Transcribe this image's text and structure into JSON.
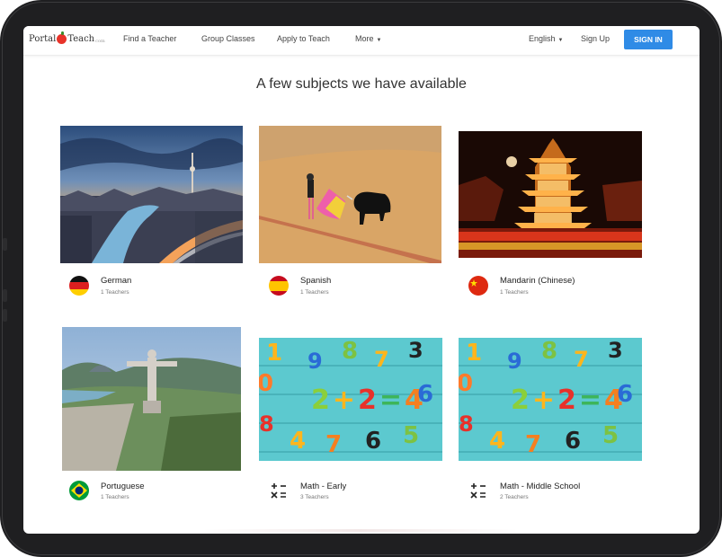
{
  "nav": {
    "logo_main": "Portal",
    "logo_second": "Teach",
    "logo_suffix": "com",
    "links": [
      "Find a Teacher",
      "Group Classes",
      "Apply to Teach",
      "More"
    ],
    "language": "English",
    "signup": "Sign Up",
    "signin": "SIGN IN"
  },
  "heading": "A few subjects we have available",
  "subjects": [
    {
      "name": "German",
      "teachers": "1 Teachers",
      "icon": "germany-flag-icon"
    },
    {
      "name": "Spanish",
      "teachers": "1 Teachers",
      "icon": "spain-flag-icon"
    },
    {
      "name": "Mandarin (Chinese)",
      "teachers": "1 Teachers",
      "icon": "china-flag-icon"
    },
    {
      "name": "Portuguese",
      "teachers": "1 Teachers",
      "icon": "brazil-flag-icon"
    },
    {
      "name": "Math - Early",
      "teachers": "3 Teachers",
      "icon": "math-icon"
    },
    {
      "name": "Math - Middle School",
      "teachers": "2 Teachers",
      "icon": "math-icon"
    }
  ],
  "colors": {
    "accent": "#2f8be6",
    "bezel": "#1f1f21",
    "text": "#333333"
  }
}
